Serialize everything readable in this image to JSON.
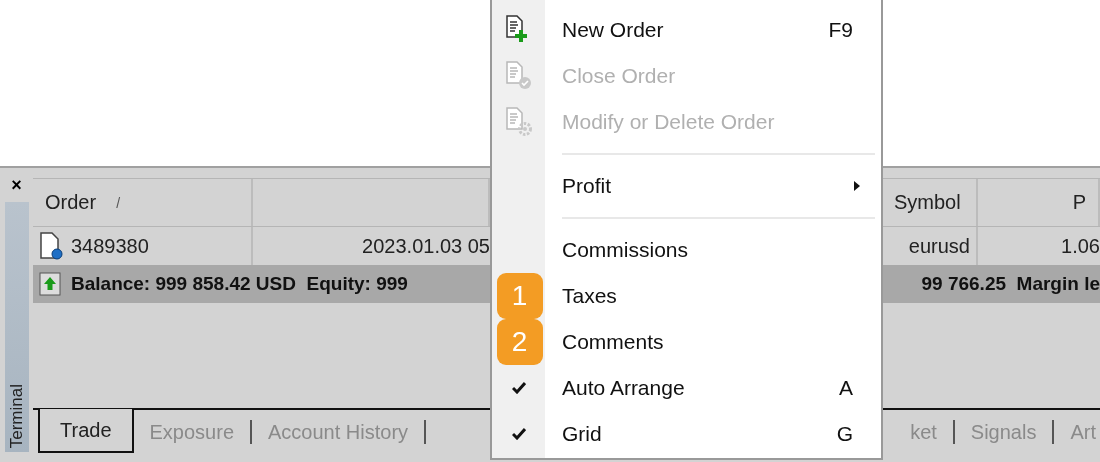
{
  "terminal": {
    "close": "×",
    "title": "Terminal",
    "header": {
      "order": "Order",
      "sort_mark": "/",
      "symbol": "Symbol",
      "price": "P"
    },
    "row": {
      "order": "3489380",
      "time": "2023.01.03 05",
      "symbol": "eurusd",
      "price": "1.06"
    },
    "balance": {
      "left": "Balance: 999 858.42 USD  Equity: 999 ",
      "right": "99 766.25  Margin le"
    },
    "tabs_left": [
      {
        "label": "Trade",
        "selected": true
      },
      {
        "label": "Exposure",
        "selected": false
      },
      {
        "label": "Account History",
        "selected": false
      }
    ],
    "tabs_right": [
      {
        "label": "ket",
        "selected": false
      },
      {
        "label": "Signals",
        "selected": false
      },
      {
        "label": "Art",
        "selected": false
      }
    ]
  },
  "menu": {
    "items": [
      {
        "kind": "new_order",
        "label": "New Order",
        "shortcut": "F9",
        "disabled": false,
        "checked": false
      },
      {
        "kind": "close_order",
        "label": "Close Order",
        "disabled": true,
        "checked": false
      },
      {
        "kind": "modify_order",
        "label": "Modify or Delete Order",
        "disabled": true,
        "checked": false
      },
      {
        "kind": "separator"
      },
      {
        "kind": "item",
        "label": "Profit",
        "submenu": true,
        "disabled": false,
        "checked": false
      },
      {
        "kind": "separator"
      },
      {
        "kind": "item",
        "label": "Commissions",
        "disabled": false,
        "checked": false
      },
      {
        "kind": "item",
        "label": "Taxes",
        "badge": "1",
        "disabled": false,
        "checked": false
      },
      {
        "kind": "item",
        "label": "Comments",
        "badge": "2",
        "disabled": false,
        "checked": false
      },
      {
        "kind": "item",
        "label": "Auto Arrange",
        "shortcut": "A",
        "disabled": false,
        "checked": true
      },
      {
        "kind": "item",
        "label": "Grid",
        "shortcut": "G",
        "disabled": false,
        "checked": true
      }
    ]
  }
}
